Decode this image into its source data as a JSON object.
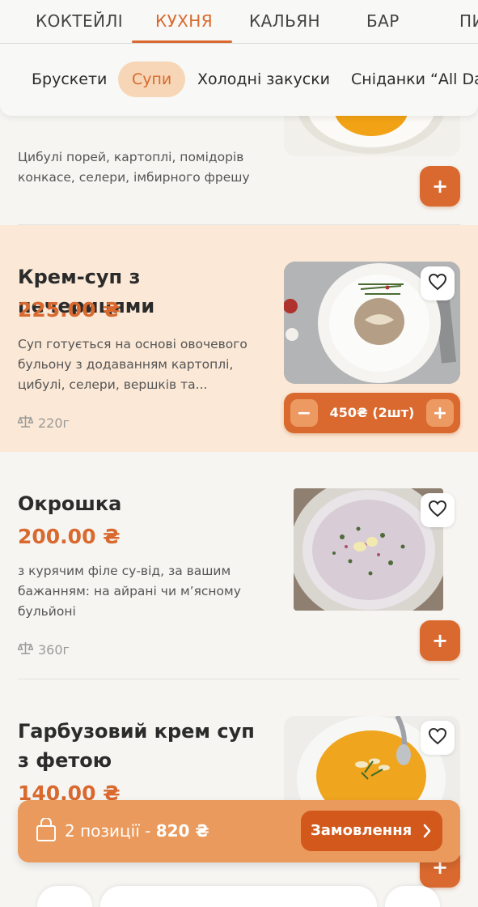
{
  "tabs": [
    "КОКТЕЙЛІ",
    "КУХНЯ",
    "КАЛЬЯН",
    "БАР",
    "ПИ"
  ],
  "active_tab": "КУХНЯ",
  "subcategories": [
    "Брускети",
    "Супи",
    "Холодні закуски",
    "Сніданки “All Day”"
  ],
  "active_subcategory": "Супи",
  "dishes": [
    {
      "description": "Цибулі порей, картоплі, помідорів конкасе, селери, імбирного фрешу",
      "action": "+"
    },
    {
      "title": "Крем-суп з печерицями",
      "price": "225.00 ₴",
      "description": "Суп готується на основі овочевого бульону з додаванням картоплі, цибулі, селери, вершків та...",
      "weight": "220г",
      "quantity_text": "450₴ (2шт)",
      "minus": "−",
      "plus": "+"
    },
    {
      "title": "Окрошка",
      "price": "200.00 ₴",
      "description": "з курячим філе су-від, за вашим бажанням: на айрані чи м’ясному бульйоні",
      "weight": "360г",
      "action": "+"
    },
    {
      "title": "Гарбузовий крем суп з фетою",
      "price": "140.00 ₴",
      "action": "+"
    }
  ],
  "cart": {
    "label": "2 позиції - ",
    "total": "820 ₴",
    "order_button": "Замовлення"
  },
  "colors": {
    "accent": "#d9692e",
    "highlight_bg": "#fbe8d6",
    "chip_active_bg": "#f6d6b6",
    "cart_bg": "#ea9a5c",
    "order_btn_bg": "#d2581c"
  },
  "icons": [
    "heart-icon",
    "scale-icon",
    "bag-icon",
    "chevron-right-icon"
  ]
}
